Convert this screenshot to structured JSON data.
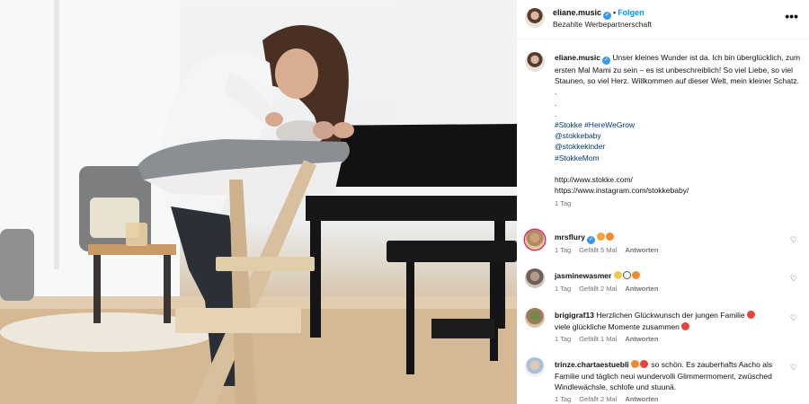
{
  "post": {
    "username": "eliane.music",
    "follow_label": "Folgen",
    "subtitle": "Bezahlte Werbepartnerschaft",
    "more_label": "•••"
  },
  "caption": {
    "username": "eliane.music",
    "text": "Unser kleines Wunder ist da. Ich bin überglücklich, zum ersten Mal Mami zu sein – es ist unbeschreiblich! So viel Liebe, so viel Staunen, so viel Herz. Willkommen auf dieser Welt, mein kleiner Schatz.",
    "dots": [
      ".",
      ".",
      "."
    ],
    "hashtags": [
      "#Stokke #HereWeGrow",
      "@stokkebaby",
      "@stokkekinder",
      "#StokkeMom"
    ],
    "links": [
      "http://www.stokke.com/",
      "https://www.instagram.com/stokkebaby/"
    ],
    "time": "1 Tag"
  },
  "comments": [
    {
      "username": "mrsflury",
      "verified": true,
      "text": "",
      "emojis": [
        "#f2a43a",
        "#f08a2e"
      ],
      "time": "1 Tag",
      "likes": "Gefällt 5 Mal",
      "reply": "Antworten"
    },
    {
      "username": "jasminewasmer",
      "verified": false,
      "text": "",
      "emojis": [
        "#f2c94c",
        "#ffffff",
        "#f08a2e"
      ],
      "time": "1 Tag",
      "likes": "Gefällt 2 Mal",
      "reply": "Antworten"
    },
    {
      "username": "brigigraf13",
      "verified": false,
      "text": "Herzlichen Glückwunsch der jungen Familie",
      "text2": "viele glückliche Momente zusammen",
      "emojis": [
        "#e8453c"
      ],
      "time": "1 Tag",
      "likes": "Gefällt 1 Mal",
      "reply": "Antworten"
    },
    {
      "username": "trinze.chartaestuebli",
      "verified": false,
      "text": "so schön. Es zauberhafts Aacho als Familie und täglich neui wundervolli Glimmermoment, zwüsched Windlewächsle, schlofe und stuunä.",
      "emojis": [
        "#f08a2e",
        "#e8453c"
      ],
      "time": "1 Tag",
      "likes": "Gefällt 2 Mal",
      "reply": "Antworten"
    }
  ],
  "icons": {
    "heart": "♡",
    "verified": "✓"
  },
  "colors": {
    "link_blue": "#0095f6",
    "hashtag_blue": "#00376b",
    "meta_gray": "#737373",
    "verified_blue": "#3897f0"
  }
}
